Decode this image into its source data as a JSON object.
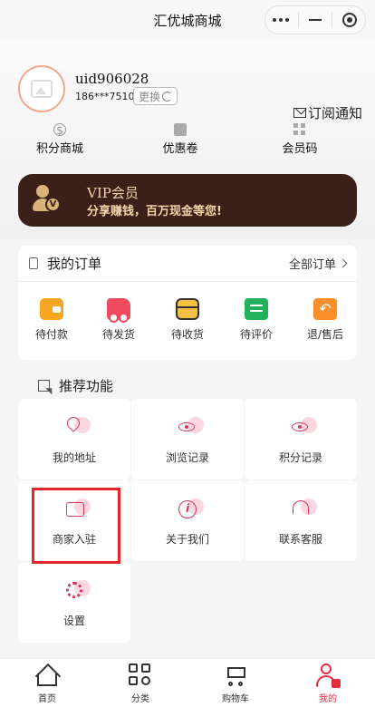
{
  "window": {
    "title": "汇优城商城",
    "capsule_icons": [
      "more-dots-icon",
      "minimize-icon",
      "close-circle-icon"
    ]
  },
  "profile": {
    "username": "uid906028",
    "phone": "186***7510",
    "change_label": "更换",
    "subscribe_label": "订阅通知"
  },
  "quick_links": [
    {
      "label": "积分商城",
      "icon": "coin-icon"
    },
    {
      "label": "优惠卷",
      "icon": "ticket-icon"
    },
    {
      "label": "会员码",
      "icon": "qrcode-icon"
    }
  ],
  "vip": {
    "title": "VIP会员",
    "subtitle": "分享赚钱，百万现金等您!"
  },
  "orders": {
    "title": "我的订单",
    "all_label": "全部订单",
    "items": [
      {
        "label": "待付款",
        "icon": "wallet-icon",
        "color": "#f6a623"
      },
      {
        "label": "待发货",
        "icon": "truck-icon",
        "color": "#ef4b5f"
      },
      {
        "label": "待收货",
        "icon": "box-icon",
        "color": "#f3c041"
      },
      {
        "label": "待评价",
        "icon": "comment-icon",
        "color": "#20b15a"
      },
      {
        "label": "退/售后",
        "icon": "refund-icon",
        "color": "#fb8f2b"
      }
    ]
  },
  "recommended": {
    "title": "推荐功能",
    "items": [
      {
        "label": "我的地址",
        "icon": "location-icon"
      },
      {
        "label": "浏览记录",
        "icon": "eye-icon"
      },
      {
        "label": "积分记录",
        "icon": "eye-icon"
      },
      {
        "label": "商家入驻",
        "icon": "store-icon"
      },
      {
        "label": "关于我们",
        "icon": "info-icon"
      },
      {
        "label": "联系客服",
        "icon": "headset-icon"
      },
      {
        "label": "设置",
        "icon": "settings-icon"
      }
    ]
  },
  "tabbar": [
    {
      "label": "首页",
      "icon": "home-icon"
    },
    {
      "label": "分类",
      "icon": "category-icon"
    },
    {
      "label": "购物车",
      "icon": "cart-icon"
    },
    {
      "label": "我的",
      "icon": "user-icon",
      "active": true
    }
  ],
  "colors": {
    "accent": "#e02e3f",
    "vip_bg": "#3a2018",
    "vip_text": "#f3d6a8",
    "highlight_border": "#e8242b"
  }
}
